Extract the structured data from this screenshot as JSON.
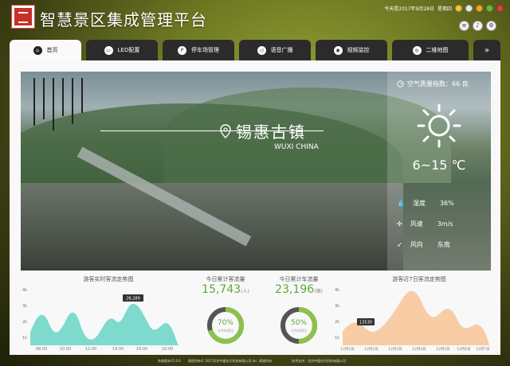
{
  "app": {
    "title": "智慧景区集成管理平台"
  },
  "topbar": {
    "date_text": "今天是2017年9月28日",
    "weekday": "星期四",
    "dots": [
      "#f5c342",
      "#e8e8e8",
      "#f2a623",
      "#6dbb3c",
      "#d9443a"
    ]
  },
  "tabs": [
    {
      "label": "首页",
      "icon": "home-icon",
      "glyph": "⌂"
    },
    {
      "label": "LED配置",
      "icon": "led-icon",
      "glyph": "▭"
    },
    {
      "label": "停车场管理",
      "icon": "parking-icon",
      "glyph": "P"
    },
    {
      "label": "语音广播",
      "icon": "speaker-icon",
      "glyph": "◁"
    },
    {
      "label": "视频监控",
      "icon": "camera-icon",
      "glyph": "◉"
    },
    {
      "label": "二维地图",
      "icon": "map-pin-icon",
      "glyph": "◎"
    },
    {
      "label": "»",
      "icon": "more-icon",
      "glyph": ""
    }
  ],
  "hero": {
    "name": "锡惠古镇",
    "sub": "WUXI CHINA"
  },
  "weather": {
    "aq_label": "空气质量指数：66 良",
    "temp": "6~15 ℃",
    "rows": [
      {
        "label": "湿度",
        "value": "36%",
        "icon": "humidity-icon"
      },
      {
        "label": "风速",
        "value": "3m/s",
        "icon": "wind-icon"
      },
      {
        "label": "风向",
        "value": "东南",
        "icon": "wind-direction-icon"
      }
    ]
  },
  "realtime": {
    "title": "游客实时客流走势图",
    "tooltip": "28,289",
    "y_ticks": [
      "4k",
      "3k",
      "2k",
      "1k"
    ],
    "x_ticks": [
      "08:00",
      "10:00",
      "12:00",
      "14:00",
      "16:00",
      "20:00"
    ]
  },
  "kpi": [
    {
      "label": "今日累计客流量",
      "value": "15,743",
      "unit": "(人)",
      "pct": "70%",
      "pct_value": 70,
      "sub": "与今年同比"
    },
    {
      "label": "今日累计车流量",
      "value": "23,196",
      "unit": "(辆)",
      "pct": "50%",
      "pct_value": 50,
      "sub": "与今年同比"
    }
  ],
  "week": {
    "title": "游客近7日客流走势图",
    "tooltip": "13530",
    "y_ticks": [
      "4k",
      "3k",
      "2k",
      "1k"
    ],
    "x_ticks": [
      "12月1日",
      "12月2日",
      "12月3日",
      "12月4日",
      "12月5日",
      "12月6日",
      "12月7日"
    ]
  },
  "footer": {
    "version": "系统版本V1.0.0",
    "copyright": "版权所有© 2017北京中量合天科技有限公司 Inc. 保留所有",
    "support": "技术支持：北京中量合天科技有限公司"
  }
}
